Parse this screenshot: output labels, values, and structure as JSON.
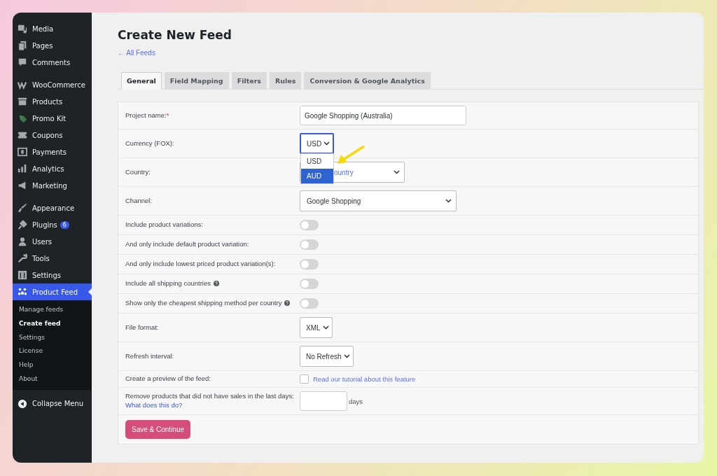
{
  "sidebar": {
    "groups": [
      {
        "items": [
          {
            "label": "Media",
            "selected": false
          },
          {
            "label": "Pages",
            "selected": false
          },
          {
            "label": "Comments",
            "selected": false
          }
        ]
      },
      {
        "items": [
          {
            "label": "WooCommerce",
            "selected": false
          },
          {
            "label": "Products",
            "selected": false
          },
          {
            "label": "Promo Kit",
            "selected": false
          },
          {
            "label": "Coupons",
            "selected": false
          },
          {
            "label": "Payments",
            "selected": false
          },
          {
            "label": "Analytics",
            "selected": false
          },
          {
            "label": "Marketing",
            "selected": false
          }
        ]
      },
      {
        "items": [
          {
            "label": "Appearance",
            "selected": false
          },
          {
            "label": "Plugins",
            "selected": false,
            "badge": "6"
          },
          {
            "label": "Users",
            "selected": false
          },
          {
            "label": "Tools",
            "selected": false
          },
          {
            "label": "Settings",
            "selected": false
          },
          {
            "label": "Product Feed",
            "selected": true,
            "submenu": [
              {
                "label": "Manage feeds",
                "selected": false
              },
              {
                "label": "Create feed",
                "selected": true
              },
              {
                "label": "Settings",
                "selected": false
              },
              {
                "label": "License",
                "selected": false
              },
              {
                "label": "Help",
                "selected": false
              },
              {
                "label": "About",
                "selected": false
              }
            ]
          }
        ]
      }
    ],
    "collapse": "Collapse Menu"
  },
  "page": {
    "title": "Create New Feed",
    "back_link": "← All Feeds"
  },
  "tabs": [
    {
      "label": "General",
      "selected": true
    },
    {
      "label": "Field Mapping",
      "selected": false
    },
    {
      "label": "Filters",
      "selected": false
    },
    {
      "label": "Rules",
      "selected": false
    },
    {
      "label": "Conversion & Google Analytics",
      "selected": false
    }
  ],
  "form": {
    "rows": [
      {
        "kind": "text",
        "label": "Project name:",
        "required_mark": "*",
        "value": "Google Shopping (Australia)"
      },
      {
        "kind": "compact-select",
        "label": "Currency (FOX):",
        "value": "USD",
        "focused": true,
        "options": [
          {
            "label": "USD",
            "highlighted": false
          },
          {
            "label": "AUD",
            "highlighted": true
          }
        ]
      },
      {
        "kind": "select",
        "label": "Country:",
        "prompt": "ountry"
      },
      {
        "kind": "wide-select",
        "label": "Channel:",
        "value": "Google Shopping"
      },
      {
        "kind": "toggle",
        "label": "Include product variations:",
        "on": false,
        "help": false
      },
      {
        "kind": "toggle",
        "label": "And only include default product variation:",
        "on": false,
        "help": false
      },
      {
        "kind": "toggle",
        "label": "And only include lowest priced product variation(s):",
        "on": false,
        "help": false
      },
      {
        "kind": "toggle",
        "label": "Include all shipping countries",
        "on": false,
        "help": true
      },
      {
        "kind": "toggle",
        "label": "Show only the cheapest shipping method per country",
        "on": false,
        "help": true
      },
      {
        "kind": "compact-select",
        "label": "File format:",
        "value": "XML"
      },
      {
        "kind": "compact-select",
        "label": "Refresh interval:",
        "value": "No Refresh"
      },
      {
        "kind": "checkbox",
        "label": "Create a preview of the feed:",
        "checked": false,
        "link": "Read our tutorial about this feature"
      },
      {
        "kind": "number",
        "label": "Remove products that did not have sales in the last days:",
        "link": "What does this do?",
        "unit": "days"
      }
    ],
    "submit": "Save & Continue"
  }
}
